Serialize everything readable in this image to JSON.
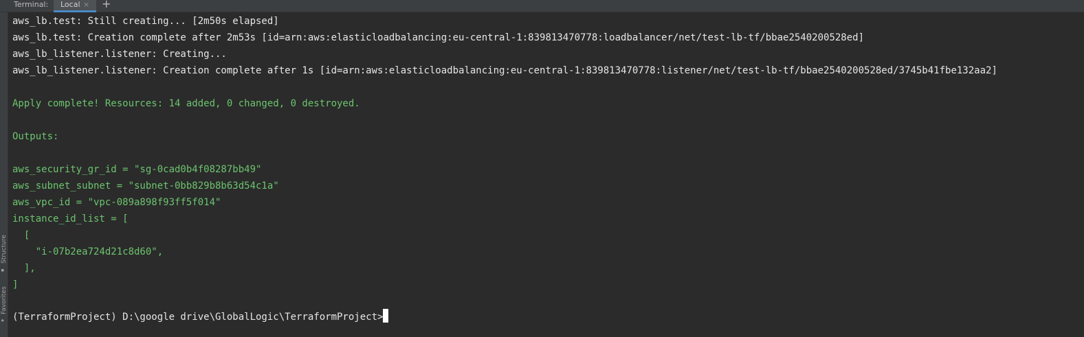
{
  "tabbar": {
    "title": "Terminal:",
    "tab_label": "Local",
    "close_glyph": "×",
    "add_glyph": "+"
  },
  "sidebar": {
    "structure_label": "Structure",
    "favorites_label": "Favorites",
    "structure_icon": "structure-icon",
    "favorites_icon": "star-icon"
  },
  "terminal": {
    "lines": [
      "aws_lb.test: Still creating... [2m50s elapsed]",
      "aws_lb.test: Creation complete after 2m53s [id=arn:aws:elasticloadbalancing:eu-central-1:839813470778:loadbalancer/net/test-lb-tf/bbae2540200528ed]",
      "aws_lb_listener.listener: Creating...",
      "aws_lb_listener.listener: Creation complete after 1s [id=arn:aws:elasticloadbalancing:eu-central-1:839813470778:listener/net/test-lb-tf/bbae2540200528ed/3745b41fbe132aa2]",
      "",
      "Apply complete! Resources: 14 added, 0 changed, 0 destroyed.",
      "",
      "Outputs:",
      "",
      "aws_security_gr_id = \"sg-0cad0b4f08287bb49\"",
      "aws_subnet_subnet = \"subnet-0bb829b8b63d54c1a\"",
      "aws_vpc_id = \"vpc-089a898f93ff5f014\"",
      "instance_id_list = [",
      "  [",
      "    \"i-07b2ea724d21c8d60\",",
      "  ],",
      "]",
      "",
      "(TerraformProject) D:\\google drive\\GlobalLogic\\TerraformProject>"
    ]
  },
  "colors": {
    "background": "#2b2b2b",
    "default_text": "#e6e6e6",
    "output_green": "#6cc46e",
    "active_tab_underline": "#4a88c7"
  }
}
